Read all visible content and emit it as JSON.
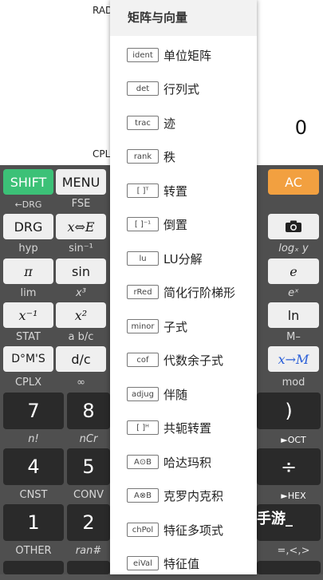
{
  "display": {
    "angle_mode": "RAD",
    "complex_mode": "CPL",
    "result": "0"
  },
  "menu": {
    "title": "矩阵与向量",
    "items": [
      {
        "icon": "ident",
        "label": "单位矩阵"
      },
      {
        "icon": "det",
        "label": "行列式"
      },
      {
        "icon": "trac",
        "label": "迹"
      },
      {
        "icon": "rank",
        "label": "秩"
      },
      {
        "icon": "[ ]ᵀ",
        "label": "转置"
      },
      {
        "icon": "[ ]⁻¹",
        "label": "倒置"
      },
      {
        "icon": "lu",
        "label": "LU分解"
      },
      {
        "icon": "rRed",
        "label": "简化行阶梯形"
      },
      {
        "icon": "minor",
        "label": "子式"
      },
      {
        "icon": "cof",
        "label": "代数余子式"
      },
      {
        "icon": "adjug",
        "label": "伴随"
      },
      {
        "icon": "[ ]ᴴ",
        "label": "共轭转置"
      },
      {
        "icon": "A⊙B",
        "label": "哈达玛积"
      },
      {
        "icon": "A⊗B",
        "label": "克罗内克积"
      },
      {
        "icon": "chPol",
        "label": "特征多项式"
      },
      {
        "icon": "eiVal",
        "label": "特征值"
      }
    ]
  },
  "keys": {
    "shift": "SHIFT",
    "menu": "MENU",
    "ac": "AC",
    "drg": "DRG",
    "x_swap_e": "x⇔E",
    "camera_icon": "camera-icon",
    "pi": "π",
    "sin": "sin",
    "e": "e",
    "x_inv": "x⁻¹",
    "x_sq": "x²",
    "ln": "ln",
    "dms": "D°M'S",
    "d_c": "d/c",
    "x_to_m": "x→M",
    "seven": "7",
    "eight": "8",
    "rparen": ")",
    "four": "4",
    "five": "5",
    "div": "÷",
    "one": "1",
    "two": "2"
  },
  "labels": {
    "l_drg": "←DRG",
    "l_fse": "FSE",
    "l_hyp": "hyp",
    "l_asin": "sin⁻¹",
    "l_logxy": "logₓ y",
    "l_lim": "lim",
    "l_x3": "x³",
    "l_ex": "eˣ",
    "l_stat": "STAT",
    "l_abc": "a b/c",
    "l_mminus": "M–",
    "l_cplx": "CPLX",
    "l_inf": "∞",
    "l_mod": "mod",
    "l_nfact": "n!",
    "l_ncr": "nCr",
    "l_oct": "►OCT",
    "l_cnst": "CNST",
    "l_conv": "CONV",
    "l_hex": "►HEX",
    "l_other": "OTHER",
    "l_ran": "ran#",
    "l_rel": "=,<,>"
  },
  "watermark": "手游_"
}
